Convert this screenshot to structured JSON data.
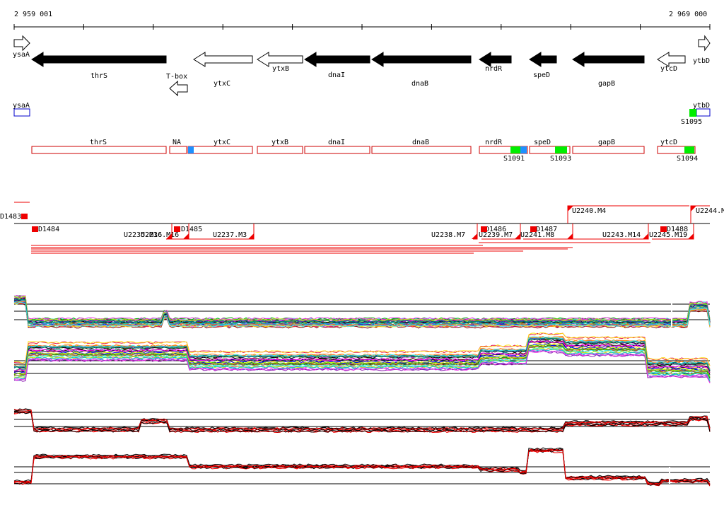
{
  "ruler": {
    "start_label": "2 959 001",
    "end_label": "2 969 000"
  },
  "genes": [
    {
      "name": "ysaA",
      "dir": "right",
      "filled": false,
      "label": "ysaA"
    },
    {
      "name": "thrS",
      "dir": "left",
      "filled": true,
      "label": "thrS"
    },
    {
      "name": "T-box",
      "dir": "left",
      "filled": false,
      "label": "T-box"
    },
    {
      "name": "ytxC",
      "dir": "left",
      "filled": false,
      "label": "ytxC"
    },
    {
      "name": "ytxB",
      "dir": "left",
      "filled": false,
      "label": "ytxB"
    },
    {
      "name": "dnaI",
      "dir": "left",
      "filled": true,
      "label": "dnaI"
    },
    {
      "name": "dnaB",
      "dir": "left",
      "filled": true,
      "label": "dnaB"
    },
    {
      "name": "nrdR",
      "dir": "left",
      "filled": true,
      "label": "nrdR"
    },
    {
      "name": "speD",
      "dir": "left",
      "filled": true,
      "label": "speD"
    },
    {
      "name": "gapB",
      "dir": "left",
      "filled": true,
      "label": "gapB"
    },
    {
      "name": "ytcD",
      "dir": "left",
      "filled": false,
      "label": "ytcD"
    },
    {
      "name": "ytbD",
      "dir": "right",
      "filled": false,
      "label": "ytbD"
    }
  ],
  "strand_boxes": {
    "forward": [
      {
        "label": "ysaA"
      },
      {
        "label": "ytbD"
      }
    ],
    "reverse": [
      {
        "label": "thrS"
      },
      {
        "label": "NA"
      },
      {
        "label": "ytxC"
      },
      {
        "label": "ytxB"
      },
      {
        "label": "dnaI"
      },
      {
        "label": "dnaB"
      },
      {
        "label": "nrdR"
      },
      {
        "label": "speD"
      },
      {
        "label": "gapB"
      },
      {
        "label": "ytcD"
      }
    ],
    "s_labels": [
      "S1095",
      "S1091",
      "S1093",
      "S1094"
    ]
  },
  "segments": {
    "d_labels": [
      "D1483",
      "D1484",
      "D1485",
      "D1486",
      "D1487",
      "D1488"
    ],
    "u_labels": [
      "U2235.M16",
      "U2236.M16",
      "U2237.M3",
      "U2238.M7",
      "U2239.M7",
      "U2240.M4",
      "U2241.M8",
      "U2243.M14",
      "U2244.M",
      "U2245.M19"
    ]
  },
  "colors": {
    "gene_fill": "#000000",
    "reverse_box": "#cc0000",
    "forward_box": "#0000cc",
    "s_green": "#00ee00",
    "s_blue": "#1e90ff",
    "segment_red": "#ee0000",
    "trace_black": "#000000",
    "trace_red": "#ee0000"
  }
}
